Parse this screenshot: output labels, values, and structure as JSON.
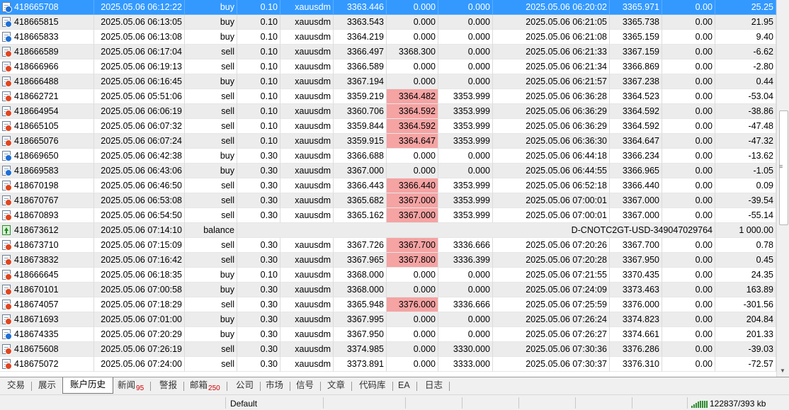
{
  "history": {
    "rows": [
      {
        "icon": "buy",
        "ticket": "418665708",
        "open_time": "2025.05.06 06:12:22",
        "type": "buy",
        "volume": "0.10",
        "symbol": "xauusdm",
        "open_price": "3363.446",
        "sl": "0.000",
        "tp": "0.000",
        "close_time": "2025.05.06 06:20:02",
        "close_price": "3365.971",
        "swap": "0.00",
        "profit": "25.25",
        "selected": true
      },
      {
        "icon": "buy",
        "ticket": "418665815",
        "open_time": "2025.05.06 06:13:05",
        "type": "buy",
        "volume": "0.10",
        "symbol": "xauusdm",
        "open_price": "3363.543",
        "sl": "0.000",
        "tp": "0.000",
        "close_time": "2025.05.06 06:21:05",
        "close_price": "3365.738",
        "swap": "0.00",
        "profit": "21.95"
      },
      {
        "icon": "buy",
        "ticket": "418665833",
        "open_time": "2025.05.06 06:13:08",
        "type": "buy",
        "volume": "0.10",
        "symbol": "xauusdm",
        "open_price": "3364.219",
        "sl": "0.000",
        "tp": "0.000",
        "close_time": "2025.05.06 06:21:08",
        "close_price": "3365.159",
        "swap": "0.00",
        "profit": "9.40"
      },
      {
        "icon": "sell",
        "ticket": "418666589",
        "open_time": "2025.05.06 06:17:04",
        "type": "sell",
        "volume": "0.10",
        "symbol": "xauusdm",
        "open_price": "3366.497",
        "sl": "3368.300",
        "tp": "0.000",
        "close_time": "2025.05.06 06:21:33",
        "close_price": "3367.159",
        "swap": "0.00",
        "profit": "-6.62"
      },
      {
        "icon": "sell",
        "ticket": "418666966",
        "open_time": "2025.05.06 06:19:13",
        "type": "sell",
        "volume": "0.10",
        "symbol": "xauusdm",
        "open_price": "3366.589",
        "sl": "0.000",
        "tp": "0.000",
        "close_time": "2025.05.06 06:21:34",
        "close_price": "3366.869",
        "swap": "0.00",
        "profit": "-2.80"
      },
      {
        "icon": "sell",
        "ticket": "418666488",
        "open_time": "2025.05.06 06:16:45",
        "type": "buy",
        "volume": "0.10",
        "symbol": "xauusdm",
        "open_price": "3367.194",
        "sl": "0.000",
        "tp": "0.000",
        "close_time": "2025.05.06 06:21:57",
        "close_price": "3367.238",
        "swap": "0.00",
        "profit": "0.44"
      },
      {
        "icon": "sell",
        "ticket": "418662721",
        "open_time": "2025.05.06 05:51:06",
        "type": "sell",
        "volume": "0.10",
        "symbol": "xauusdm",
        "open_price": "3359.219",
        "sl": "3364.482",
        "tp": "3353.999",
        "close_time": "2025.05.06 06:36:28",
        "close_price": "3364.523",
        "swap": "0.00",
        "profit": "-53.04",
        "sl_hit": true
      },
      {
        "icon": "sell",
        "ticket": "418664954",
        "open_time": "2025.05.06 06:06:19",
        "type": "sell",
        "volume": "0.10",
        "symbol": "xauusdm",
        "open_price": "3360.706",
        "sl": "3364.592",
        "tp": "3353.999",
        "close_time": "2025.05.06 06:36:29",
        "close_price": "3364.592",
        "swap": "0.00",
        "profit": "-38.86",
        "sl_hit": true
      },
      {
        "icon": "sell",
        "ticket": "418665105",
        "open_time": "2025.05.06 06:07:32",
        "type": "sell",
        "volume": "0.10",
        "symbol": "xauusdm",
        "open_price": "3359.844",
        "sl": "3364.592",
        "tp": "3353.999",
        "close_time": "2025.05.06 06:36:29",
        "close_price": "3364.592",
        "swap": "0.00",
        "profit": "-47.48",
        "sl_hit": true
      },
      {
        "icon": "sell",
        "ticket": "418665076",
        "open_time": "2025.05.06 06:07:24",
        "type": "sell",
        "volume": "0.10",
        "symbol": "xauusdm",
        "open_price": "3359.915",
        "sl": "3364.647",
        "tp": "3353.999",
        "close_time": "2025.05.06 06:36:30",
        "close_price": "3364.647",
        "swap": "0.00",
        "profit": "-47.32",
        "sl_hit": true
      },
      {
        "icon": "buy",
        "ticket": "418669650",
        "open_time": "2025.05.06 06:42:38",
        "type": "buy",
        "volume": "0.30",
        "symbol": "xauusdm",
        "open_price": "3366.688",
        "sl": "0.000",
        "tp": "0.000",
        "close_time": "2025.05.06 06:44:18",
        "close_price": "3366.234",
        "swap": "0.00",
        "profit": "-13.62"
      },
      {
        "icon": "buy",
        "ticket": "418669583",
        "open_time": "2025.05.06 06:43:06",
        "type": "buy",
        "volume": "0.30",
        "symbol": "xauusdm",
        "open_price": "3367.000",
        "sl": "0.000",
        "tp": "0.000",
        "close_time": "2025.05.06 06:44:55",
        "close_price": "3366.965",
        "swap": "0.00",
        "profit": "-1.05"
      },
      {
        "icon": "sell",
        "ticket": "418670198",
        "open_time": "2025.05.06 06:46:50",
        "type": "sell",
        "volume": "0.30",
        "symbol": "xauusdm",
        "open_price": "3366.443",
        "sl": "3366.440",
        "tp": "3353.999",
        "close_time": "2025.05.06 06:52:18",
        "close_price": "3366.440",
        "swap": "0.00",
        "profit": "0.09",
        "sl_hit": true
      },
      {
        "icon": "sell",
        "ticket": "418670767",
        "open_time": "2025.05.06 06:53:08",
        "type": "sell",
        "volume": "0.30",
        "symbol": "xauusdm",
        "open_price": "3365.682",
        "sl": "3367.000",
        "tp": "3353.999",
        "close_time": "2025.05.06 07:00:01",
        "close_price": "3367.000",
        "swap": "0.00",
        "profit": "-39.54",
        "sl_hit": true
      },
      {
        "icon": "sell",
        "ticket": "418670893",
        "open_time": "2025.05.06 06:54:50",
        "type": "sell",
        "volume": "0.30",
        "symbol": "xauusdm",
        "open_price": "3365.162",
        "sl": "3367.000",
        "tp": "3353.999",
        "close_time": "2025.05.06 07:00:01",
        "close_price": "3367.000",
        "swap": "0.00",
        "profit": "-55.14",
        "sl_hit": true
      },
      {
        "icon": "balance",
        "ticket": "418673612",
        "open_time": "2025.05.06 07:14:10",
        "type": "balance",
        "comment": "D-CNOTC2GT-USD-349047029764",
        "profit": "1 000.00"
      },
      {
        "icon": "sell",
        "ticket": "418673710",
        "open_time": "2025.05.06 07:15:09",
        "type": "sell",
        "volume": "0.30",
        "symbol": "xauusdm",
        "open_price": "3367.726",
        "sl": "3367.700",
        "tp": "3336.666",
        "close_time": "2025.05.06 07:20:26",
        "close_price": "3367.700",
        "swap": "0.00",
        "profit": "0.78",
        "sl_hit": true
      },
      {
        "icon": "sell",
        "ticket": "418673832",
        "open_time": "2025.05.06 07:16:42",
        "type": "sell",
        "volume": "0.30",
        "symbol": "xauusdm",
        "open_price": "3367.965",
        "sl": "3367.800",
        "tp": "3336.399",
        "close_time": "2025.05.06 07:20:28",
        "close_price": "3367.950",
        "swap": "0.00",
        "profit": "0.45",
        "sl_hit": true
      },
      {
        "icon": "sell",
        "ticket": "418666645",
        "open_time": "2025.05.06 06:18:35",
        "type": "buy",
        "volume": "0.10",
        "symbol": "xauusdm",
        "open_price": "3368.000",
        "sl": "0.000",
        "tp": "0.000",
        "close_time": "2025.05.06 07:21:55",
        "close_price": "3370.435",
        "swap": "0.00",
        "profit": "24.35"
      },
      {
        "icon": "sell",
        "ticket": "418670101",
        "open_time": "2025.05.06 07:00:58",
        "type": "buy",
        "volume": "0.30",
        "symbol": "xauusdm",
        "open_price": "3368.000",
        "sl": "0.000",
        "tp": "0.000",
        "close_time": "2025.05.06 07:24:09",
        "close_price": "3373.463",
        "swap": "0.00",
        "profit": "163.89"
      },
      {
        "icon": "sell",
        "ticket": "418674057",
        "open_time": "2025.05.06 07:18:29",
        "type": "sell",
        "volume": "0.30",
        "symbol": "xauusdm",
        "open_price": "3365.948",
        "sl": "3376.000",
        "tp": "3336.666",
        "close_time": "2025.05.06 07:25:59",
        "close_price": "3376.000",
        "swap": "0.00",
        "profit": "-301.56",
        "sl_hit": true
      },
      {
        "icon": "sell",
        "ticket": "418671693",
        "open_time": "2025.05.06 07:01:00",
        "type": "buy",
        "volume": "0.30",
        "symbol": "xauusdm",
        "open_price": "3367.995",
        "sl": "0.000",
        "tp": "0.000",
        "close_time": "2025.05.06 07:26:24",
        "close_price": "3374.823",
        "swap": "0.00",
        "profit": "204.84"
      },
      {
        "icon": "buy",
        "ticket": "418674335",
        "open_time": "2025.05.06 07:20:29",
        "type": "buy",
        "volume": "0.30",
        "symbol": "xauusdm",
        "open_price": "3367.950",
        "sl": "0.000",
        "tp": "0.000",
        "close_time": "2025.05.06 07:26:27",
        "close_price": "3374.661",
        "swap": "0.00",
        "profit": "201.33"
      },
      {
        "icon": "sell",
        "ticket": "418675608",
        "open_time": "2025.05.06 07:26:19",
        "type": "sell",
        "volume": "0.30",
        "symbol": "xauusdm",
        "open_price": "3374.985",
        "sl": "0.000",
        "tp": "3330.000",
        "close_time": "2025.05.06 07:30:36",
        "close_price": "3376.286",
        "swap": "0.00",
        "profit": "-39.03"
      },
      {
        "icon": "sell",
        "ticket": "418675072",
        "open_time": "2025.05.06 07:24:00",
        "type": "sell",
        "volume": "0.30",
        "symbol": "xauusdm",
        "open_price": "3373.891",
        "sl": "0.000",
        "tp": "3333.000",
        "close_time": "2025.05.06 07:30:37",
        "close_price": "3376.310",
        "swap": "0.00",
        "profit": "-72.57"
      }
    ]
  },
  "tabs": [
    {
      "label": "交易"
    },
    {
      "label": "展示"
    },
    {
      "label": "账户历史",
      "active": true
    },
    {
      "label": "新闻",
      "badge": "95"
    },
    {
      "label": "警报"
    },
    {
      "label": "邮箱",
      "badge": "250"
    },
    {
      "label": "公司"
    },
    {
      "label": "市场"
    },
    {
      "label": "信号"
    },
    {
      "label": "文章"
    },
    {
      "label": "代码库"
    },
    {
      "label": "EA"
    },
    {
      "label": "日志"
    }
  ],
  "status": {
    "profile": "Default",
    "traffic": "122837/393 kb"
  },
  "colors": {
    "selected_row": "#3399ff",
    "sl_hit_highlight": "#f5a3a3",
    "buy_dot": "#1d6fd6",
    "sell_dot": "#e0451f",
    "badge": "#d00000"
  }
}
